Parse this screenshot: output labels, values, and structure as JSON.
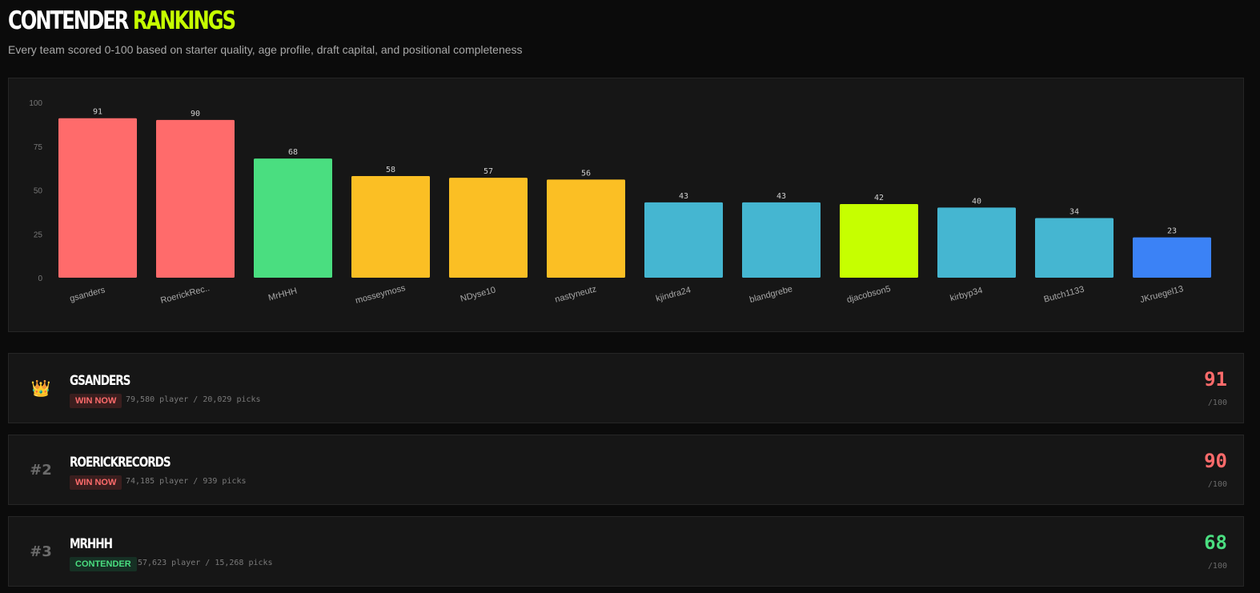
{
  "header": {
    "title_part1": "CONTENDER",
    "title_part2": "RANKINGS",
    "subtitle": "Every team scored 0-100 based on starter quality, age profile, draft capital, and positional completeness"
  },
  "colors": {
    "accent": "#c6ff00",
    "win_now": "#ff6b6b",
    "contender": "#4ade80",
    "mid": "#fbbf24",
    "rebuild": "#45b6d1",
    "lime": "#c6ff00",
    "low": "#3b82f6"
  },
  "chart_data": {
    "type": "bar",
    "categories": [
      "gsanders",
      "RoerickRec..",
      "MrHHH",
      "mosseymoss",
      "NDyse10",
      "nastyneutz",
      "kjindra24",
      "blandgrebe",
      "djacobson5",
      "kirbyp34",
      "Butch1133",
      "JKruegel13"
    ],
    "values": [
      91,
      90,
      68,
      58,
      57,
      56,
      43,
      43,
      42,
      40,
      34,
      23
    ],
    "value_labels": [
      "91",
      "90",
      "68",
      "58",
      "57",
      "56",
      "43",
      "43",
      "42",
      "40",
      "34",
      "23"
    ],
    "bar_colors": [
      "#ff6b6b",
      "#ff6b6b",
      "#4ade80",
      "#fbbf24",
      "#fbbf24",
      "#fbbf24",
      "#45b6d1",
      "#45b6d1",
      "#c6ff00",
      "#45b6d1",
      "#45b6d1",
      "#3b82f6"
    ],
    "y_ticks": [
      "100",
      "75",
      "50",
      "25",
      "0"
    ],
    "ylim": [
      0,
      100
    ],
    "grid": false,
    "title": "",
    "xlabel": "",
    "ylabel": ""
  },
  "teams": [
    {
      "rank_icon": "👑",
      "name": "gsanders",
      "badge": "WIN NOW",
      "meta": "79,580 player / 20,029 picks",
      "score": "91",
      "score_max": "/100",
      "score_color": "#ff6b6b"
    },
    {
      "rank": "#2",
      "name": "RoerickRecords",
      "badge": "WIN NOW",
      "meta": "74,185 player / 939 picks",
      "score": "90",
      "score_max": "/100",
      "score_color": "#ff6b6b"
    },
    {
      "rank": "#3",
      "name": "MrHHH",
      "badge": "CONTENDER",
      "meta": "57,623 player / 15,268 picks",
      "score": "68",
      "score_max": "/100",
      "score_color": "#4ade80"
    }
  ]
}
